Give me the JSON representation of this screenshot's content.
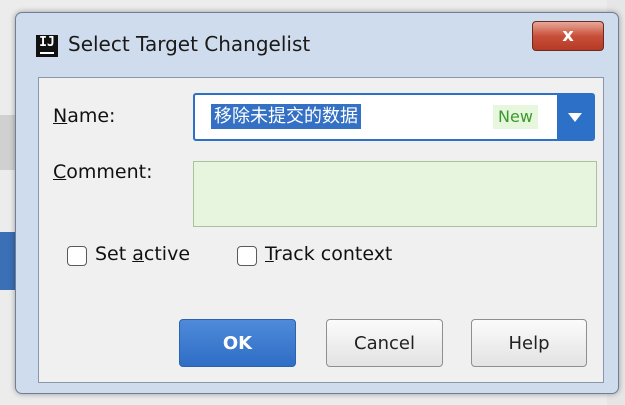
{
  "window": {
    "title": "Select Target Changelist",
    "app_icon_text": "IJ",
    "close_symbol": "x"
  },
  "form": {
    "name_label_mnemonic": "N",
    "name_label_rest": "ame:",
    "name_value": "移除未提交的数据",
    "name_badge": "New",
    "comment_label_mnemonic": "C",
    "comment_label_rest": "omment:",
    "comment_value": ""
  },
  "options": {
    "set_active_prefix": "Set ",
    "set_active_mnemonic": "a",
    "set_active_suffix": "ctive",
    "set_active_checked": false,
    "track_context_mnemonic": "T",
    "track_context_suffix": "rack context",
    "track_context_checked": false
  },
  "buttons": {
    "ok": "OK",
    "cancel": "Cancel",
    "help": "Help"
  },
  "colors": {
    "accent": "#2c70c8",
    "selection": "#3470c4",
    "comment_bg": "#e7f5df",
    "badge_text": "#3b9a2b",
    "close_red": "#c8503a"
  },
  "icons": {
    "close": "close-icon",
    "dropdown": "chevron-down-icon",
    "app": "intellij-logo-icon"
  }
}
